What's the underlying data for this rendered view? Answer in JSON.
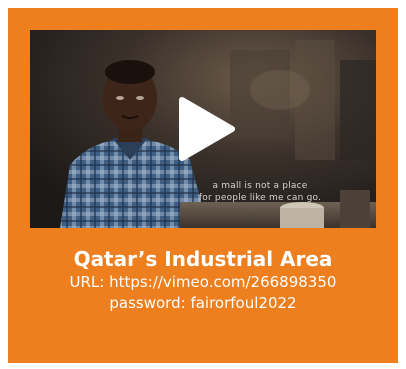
{
  "video": {
    "caption_line1": "a mall is not a place",
    "caption_line2": "for people like me can go.",
    "play_icon": "play-icon"
  },
  "info": {
    "title": "Qatar’s Industrial Area",
    "url_label": "URL:",
    "url": "https://vimeo.com/266898350",
    "password_label": "password:",
    "password": "fairorfoul2022"
  },
  "colors": {
    "card_background": "#ee7f1f",
    "text": "#ffffff",
    "play_button": "#ffffff"
  }
}
